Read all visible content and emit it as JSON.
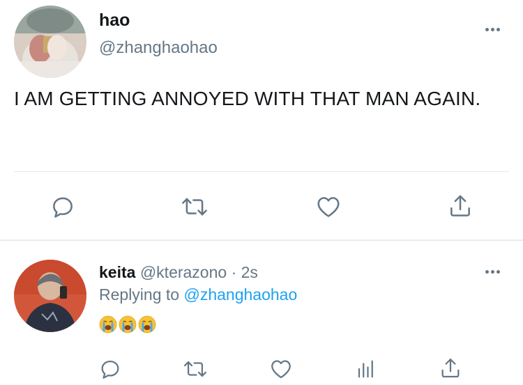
{
  "main_tweet": {
    "author_name": "hao",
    "author_handle": "@zhanghaohao",
    "text": "I AM GETTING ANNOYED WITH THAT MAN AGAIN.",
    "actions": [
      "reply-icon",
      "retweet-icon",
      "like-icon",
      "share-icon"
    ]
  },
  "reply_tweet": {
    "author_name": "keita",
    "author_handle": "@kterazono",
    "separator": "·",
    "time": "2s",
    "replying_prefix": "Replying to",
    "replying_to": "@zhanghaohao",
    "emoji_text": "😭😭😭",
    "actions": [
      "reply-icon",
      "retweet-icon",
      "like-icon",
      "analytics-icon",
      "share-icon"
    ]
  },
  "colors": {
    "text": "#14171a",
    "secondary": "#657786",
    "link": "#1da1f2",
    "divider": "#e1e8ed"
  }
}
